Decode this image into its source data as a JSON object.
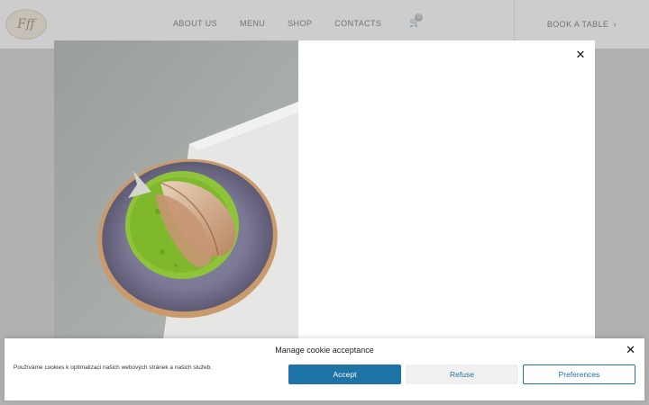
{
  "header": {
    "logo_text": "Fff",
    "nav": [
      "ABOUT US",
      "MENU",
      "SHOP",
      "CONTACTS"
    ],
    "cart_count": "0",
    "book_label": "BOOK A TABLE",
    "book_icon": "chevron-right-icon"
  },
  "modal": {
    "close_icon": "close-icon",
    "image_alt": "fish-dish-photo"
  },
  "cookie": {
    "title": "Manage cookie acceptance",
    "text": "Používáme cookies k optimalizaci našich webových stránek a našich služeb.",
    "accept": "Accept",
    "refuse": "Refuse",
    "preferences": "Preferences",
    "accent_color": "#1e73a7"
  }
}
